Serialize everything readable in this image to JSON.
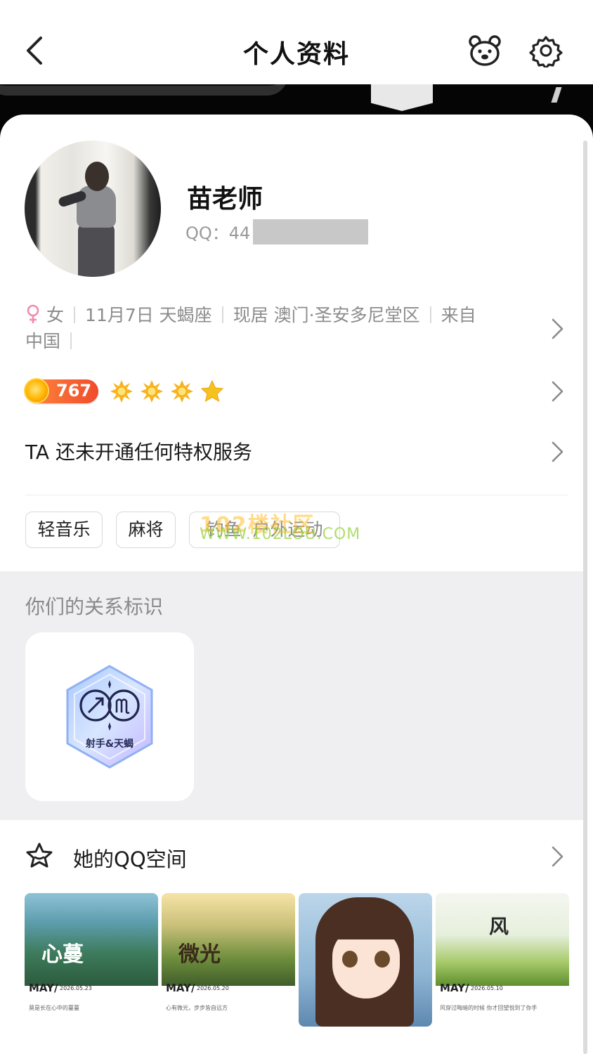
{
  "nav": {
    "title": "个人资料",
    "back_icon": "chevron-left-icon",
    "bear_icon": "bear-face-icon",
    "settings_icon": "gear-icon"
  },
  "profile": {
    "name": "苗老师",
    "qq_label": "QQ：44",
    "gender": "女",
    "birthday": "11月7日 天蝎座",
    "location": "现居 澳门·圣安多尼堂区",
    "hometown_prefix": "来自",
    "hometown": "中国",
    "level": "767",
    "privilege_text": "TA 还未开通任何特权服务"
  },
  "tags": [
    "轻音乐",
    "麻将",
    "钓鱼",
    "户外运动"
  ],
  "watermark": {
    "line1": "102楼社区",
    "line2": "WWW.102LOU.COM"
  },
  "relation": {
    "title": "你们的关系标识",
    "badge_label": "射手&天蝎"
  },
  "qzone": {
    "title": "她的QQ空间",
    "photos": [
      {
        "title": "心蔓",
        "may": "MAY/",
        "date": "2026.05.23",
        "caption": "莫是长在心中的蔓蔓"
      },
      {
        "title": "微光",
        "may": "MAY/",
        "date": "2026.05.20",
        "caption": "心有微光，步步皆自远方"
      },
      {
        "title": "",
        "may": "",
        "date": "",
        "caption": ""
      },
      {
        "title": "风",
        "may": "MAY/",
        "date": "2026.05.10",
        "caption": "风穿过晦暗的时候 你才回望悦到了你手"
      }
    ]
  },
  "colors": {
    "accent_pink": "#f08bb0",
    "level_orange": "#f2592e",
    "section_gray": "#efeff1"
  }
}
